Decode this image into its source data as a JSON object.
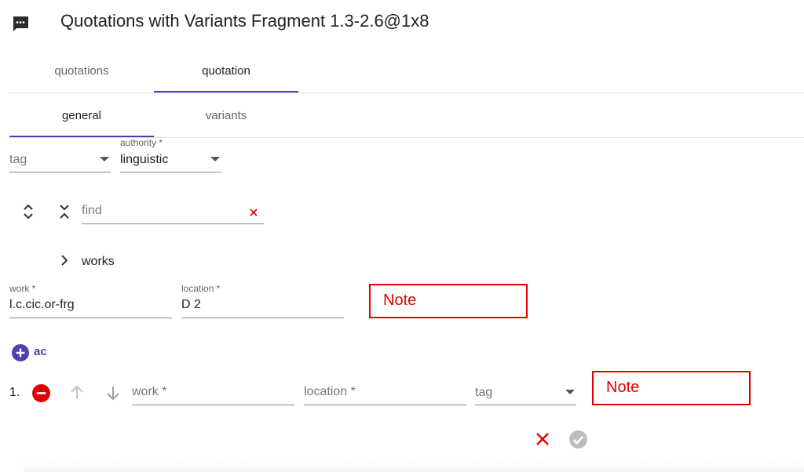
{
  "header": {
    "title": "Quotations with Variants Fragment 1.3-2.6@1x8",
    "icon": "chat-bubble-icon"
  },
  "tabs_main": [
    {
      "label": "quotations",
      "active": false
    },
    {
      "label": "quotation",
      "active": true
    }
  ],
  "tabs_sub": [
    {
      "label": "general",
      "active": true
    },
    {
      "label": "variants",
      "active": false
    }
  ],
  "filters": {
    "tag_placeholder": "tag",
    "authority_label": "authority *",
    "authority_value": "linguistic"
  },
  "finder": {
    "placeholder": "find",
    "expand_icon": "unfold-more-icon",
    "collapse_icon": "unfold-less-icon",
    "clear_icon": "close-icon"
  },
  "tree": {
    "node_label": "works",
    "chevron_icon": "chevron-right-icon"
  },
  "work_entry": {
    "work_label": "work *",
    "work_value": "l.c.cic.or-frg",
    "location_label": "location *",
    "location_value": "D 2",
    "note_label": "Note"
  },
  "add_button": {
    "label": "ac",
    "icon": "add-circle-icon"
  },
  "variant_row": {
    "number": "1.",
    "work_placeholder": "work *",
    "location_placeholder": "location *",
    "tag_placeholder": "tag",
    "note_label": "Note",
    "remove_icon": "remove-circle-icon",
    "up_icon": "arrow-up-icon",
    "down_icon": "arrow-down-icon"
  },
  "actions": {
    "cancel_icon": "close-icon",
    "save_icon": "check-circle-icon"
  },
  "colors": {
    "accent": "#4b3fb5",
    "danger": "#e00000",
    "disabled": "#bdbdbd"
  }
}
